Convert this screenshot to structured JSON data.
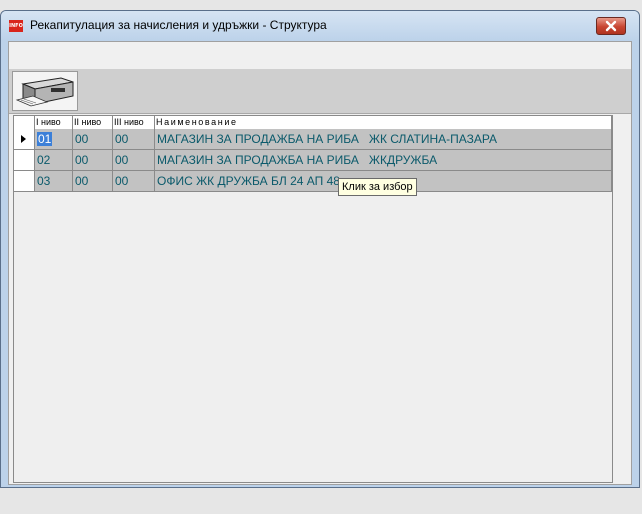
{
  "window": {
    "title": "Рекапитулация за начисления и удръжки - Структура",
    "app_icon_text": "INFO"
  },
  "grid": {
    "columns": [
      "I ниво",
      "II ниво",
      "III ниво",
      "Наименование"
    ],
    "rows": [
      {
        "level1": "01",
        "level2": "00",
        "level3": "00",
        "name": "МАГАЗИН ЗА ПРОДАЖБА НА РИБА   ЖК СЛАТИНА-ПАЗАРА",
        "current": true
      },
      {
        "level1": "02",
        "level2": "00",
        "level3": "00",
        "name": "МАГАЗИН ЗА ПРОДАЖБА НА РИБА   ЖКДРУЖБА",
        "current": false
      },
      {
        "level1": "03",
        "level2": "00",
        "level3": "00",
        "name": "ОФИС ЖК ДРУЖБА БЛ 24 АП 48",
        "current": false
      }
    ]
  },
  "tooltip": {
    "text": "Клик за избор"
  },
  "icons": {
    "close": "close-icon",
    "print": "printer-icon",
    "row_indicator": "row-pointer-icon"
  },
  "colors": {
    "title_bar": "#bcd2ea",
    "close_button": "#c84532",
    "cell_background": "#c2c2c2",
    "cell_text": "#0b5a6b",
    "selection": "#3b7fd8",
    "tooltip_background": "#ffffe1"
  }
}
